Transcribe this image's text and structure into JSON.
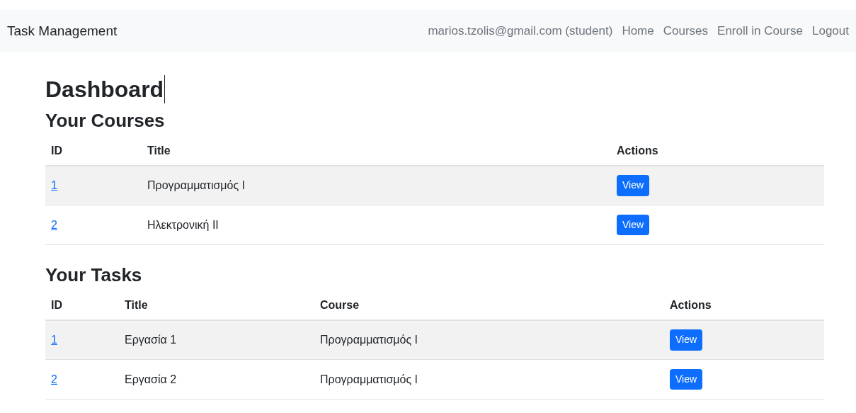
{
  "navbar": {
    "brand": "Task Management",
    "user": "marios.tzolis@gmail.com (student)",
    "links": [
      "Home",
      "Courses",
      "Enroll in Course",
      "Logout"
    ]
  },
  "heading": "Dashboard",
  "courses": {
    "title": "Your Courses",
    "columns": [
      "ID",
      "Title",
      "Actions"
    ],
    "rows": [
      {
        "id": "1",
        "title": "Προγραμματισμός Ι",
        "action": "View"
      },
      {
        "id": "2",
        "title": "Ηλεκτρονική ΙΙ",
        "action": "View"
      }
    ]
  },
  "tasks": {
    "title": "Your Tasks",
    "columns": [
      "ID",
      "Title",
      "Course",
      "Actions"
    ],
    "rows": [
      {
        "id": "1",
        "title": "Εργασία 1",
        "course": "Προγραμματισμός Ι",
        "action": "View"
      },
      {
        "id": "2",
        "title": "Εργασία 2",
        "course": "Προγραμματισμός Ι",
        "action": "View"
      }
    ]
  }
}
